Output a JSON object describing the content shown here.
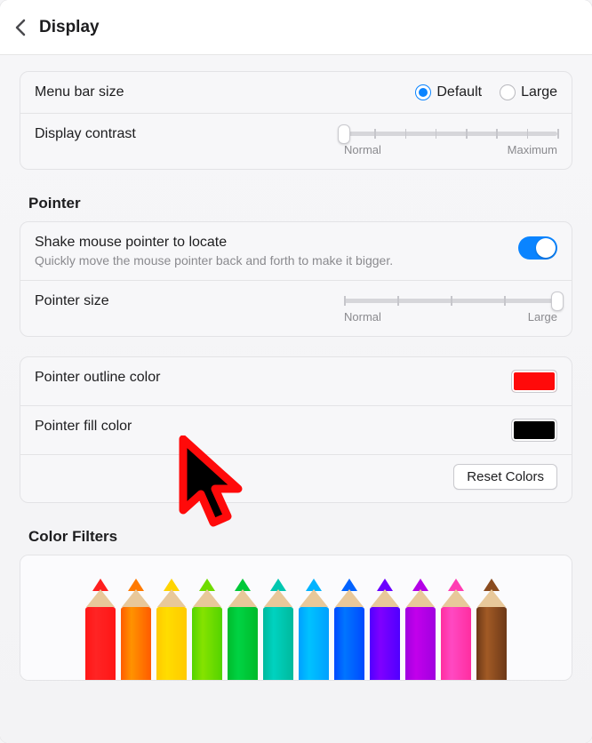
{
  "header": {
    "title": "Display"
  },
  "menu_bar_size": {
    "label": "Menu bar size",
    "options": [
      {
        "label": "Default",
        "selected": true
      },
      {
        "label": "Large",
        "selected": false
      }
    ]
  },
  "display_contrast": {
    "label": "Display contrast",
    "min_label": "Normal",
    "max_label": "Maximum",
    "value_pct": 0,
    "ticks": 8
  },
  "pointer_section": {
    "title": "Pointer"
  },
  "shake_to_locate": {
    "label": "Shake mouse pointer to locate",
    "sub": "Quickly move the mouse pointer back and forth to make it bigger.",
    "enabled": true
  },
  "pointer_size": {
    "label": "Pointer size",
    "min_label": "Normal",
    "max_label": "Large",
    "value_pct": 100,
    "ticks": 5
  },
  "pointer_outline": {
    "label": "Pointer outline color",
    "color": "#ff0a0a"
  },
  "pointer_fill": {
    "label": "Pointer fill color",
    "color": "#000000"
  },
  "reset_colors": {
    "label": "Reset Colors"
  },
  "cursor_preview": {
    "outline": "#ff0a0a",
    "fill": "#000000"
  },
  "color_filters": {
    "title": "Color Filters",
    "pencils": [
      "#ff1e1e",
      "#ff7a00",
      "#ffd400",
      "#6fdc00",
      "#00c838",
      "#00c7b0",
      "#00b3ff",
      "#0062ff",
      "#6a00ff",
      "#b300e6",
      "#ff3db3",
      "#8a4b1f"
    ]
  }
}
